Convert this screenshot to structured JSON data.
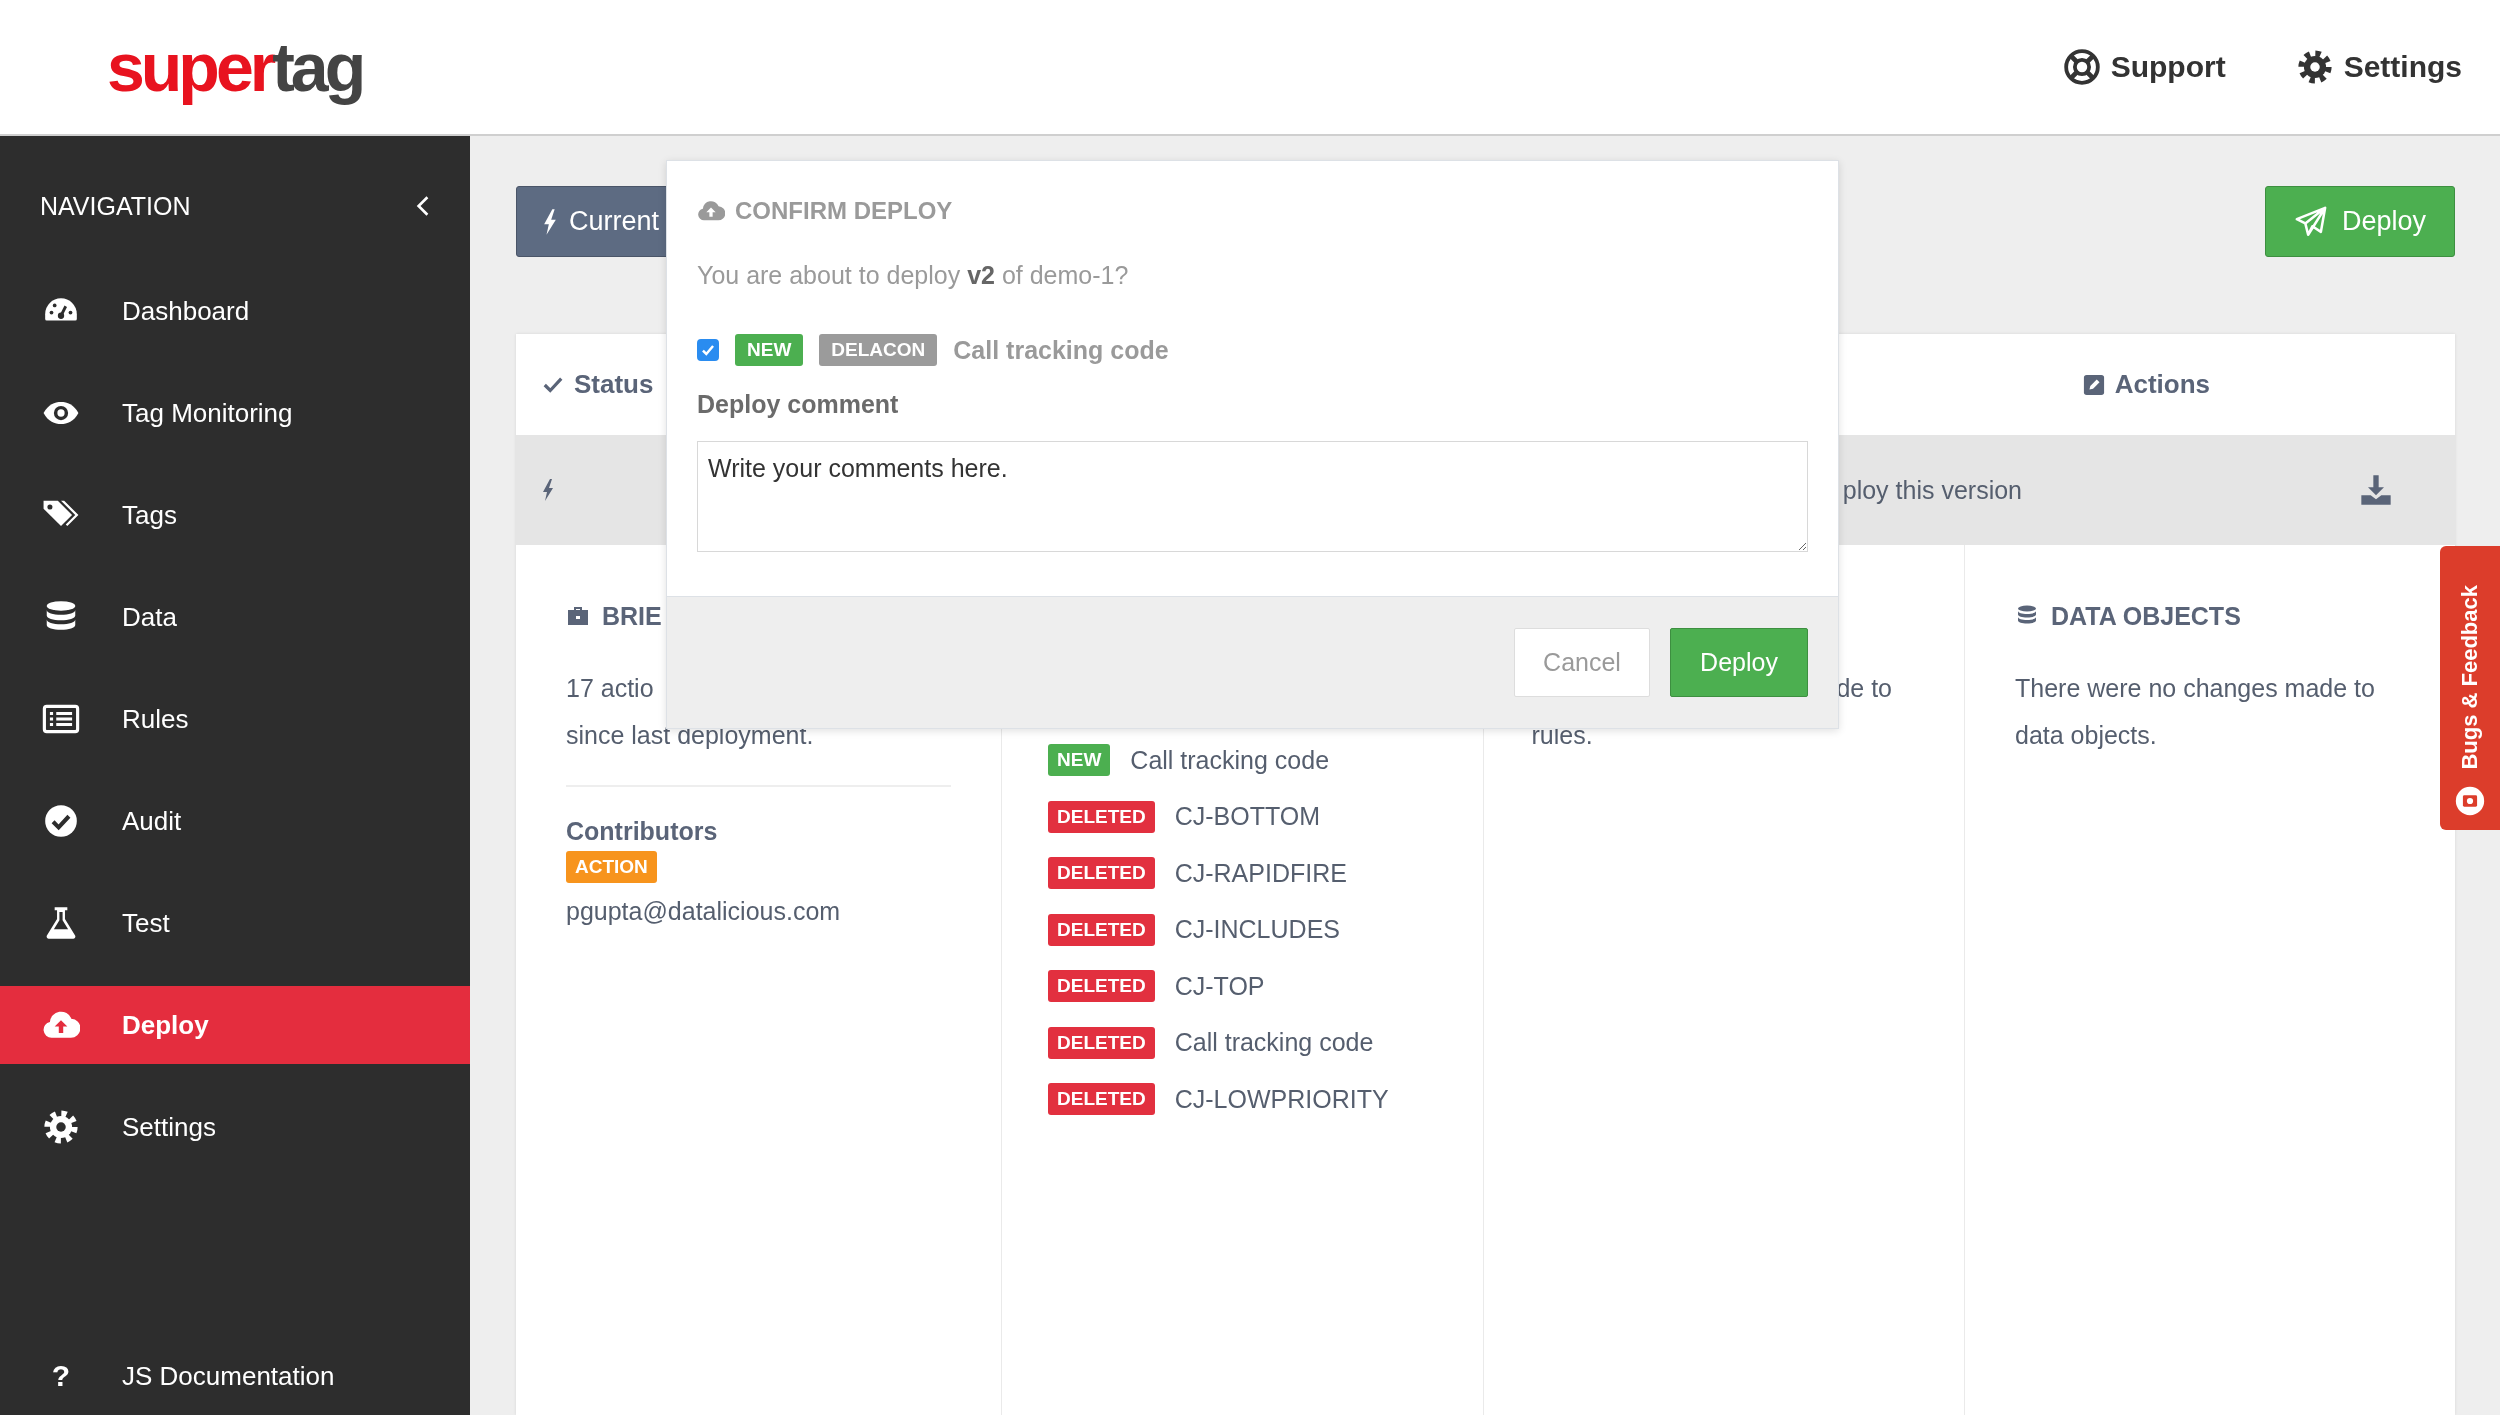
{
  "header": {
    "logo": [
      {
        "text": "super",
        "kind": "primary"
      },
      {
        "text": "tag",
        "kind": "secondary"
      }
    ],
    "links": [
      {
        "label": "Support"
      },
      {
        "label": "Settings"
      }
    ]
  },
  "sidebar": {
    "title": "NAVIGATION",
    "items": [
      {
        "label": "Dashboard",
        "selected": false
      },
      {
        "label": "Tag Monitoring",
        "selected": false
      },
      {
        "label": "Tags",
        "selected": false
      },
      {
        "label": "Data",
        "selected": false
      },
      {
        "label": "Rules",
        "selected": false
      },
      {
        "label": "Audit",
        "selected": false
      },
      {
        "label": "Test",
        "selected": false
      },
      {
        "label": "Deploy",
        "selected": true
      },
      {
        "label": "Settings",
        "selected": false
      }
    ],
    "footer": {
      "glyph": "?",
      "label": "JS Documentation"
    }
  },
  "toolbar": {
    "current_button": "Current",
    "deploy_button": "Deploy"
  },
  "card": {
    "headers": [
      {
        "label": "Status"
      },
      {
        "label": "Actions"
      }
    ],
    "row_text": "ploy this version",
    "columns": [
      {
        "title": "BRIE",
        "lines": [
          "17 actio",
          "since last deployment."
        ],
        "contributors_title": "Contributors",
        "role_badge": "ACTION",
        "email": "pgupta@datalicious.com"
      },
      {
        "changes": [
          {
            "badge": "NEW",
            "kind": "new",
            "name": "Call tracking code"
          },
          {
            "badge": "DELETED",
            "kind": "deleted",
            "name": "CJ-BOTTOM"
          },
          {
            "badge": "DELETED",
            "kind": "deleted",
            "name": "CJ-RAPIDFIRE"
          },
          {
            "badge": "DELETED",
            "kind": "deleted",
            "name": "CJ-INCLUDES"
          },
          {
            "badge": "DELETED",
            "kind": "deleted",
            "name": "CJ-TOP"
          },
          {
            "badge": "DELETED",
            "kind": "deleted",
            "name": "Call tracking code"
          },
          {
            "badge": "DELETED",
            "kind": "deleted",
            "name": "CJ-LOWPRIORITY"
          }
        ]
      },
      {
        "lines": [
          "de to",
          "rules."
        ]
      },
      {
        "title": "DATA OBJECTS",
        "text": "There were no changes made to data objects."
      }
    ]
  },
  "modal": {
    "title": "CONFIRM DEPLOY",
    "message": "You are about to deploy **v2** of demo-1?",
    "item": {
      "checked": true,
      "badges": [
        {
          "text": "NEW",
          "kind": "new"
        },
        {
          "text": "DELACON",
          "kind": "vendor"
        }
      ],
      "name": "Call tracking code"
    },
    "comment_label": "Deploy comment",
    "comment_value": "Write your comments here.",
    "cancel_button": "Cancel",
    "deploy_button": "Deploy"
  },
  "feedback_tab": "Bugs & Feedback"
}
